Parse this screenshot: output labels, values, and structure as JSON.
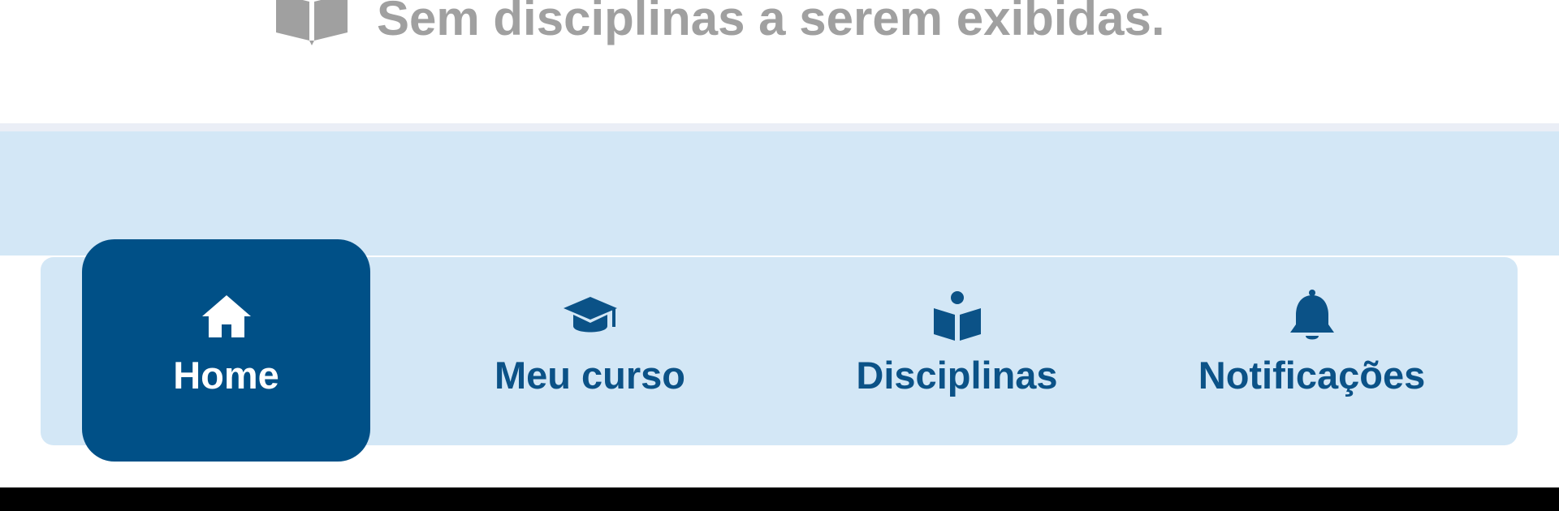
{
  "empty_state": {
    "icon": "book-icon",
    "message": "Sem disciplinas a serem exibidas."
  },
  "bottom_nav": {
    "active_index": 0,
    "items": [
      {
        "label": "Home",
        "icon": "home-icon"
      },
      {
        "label": "Meu curso",
        "icon": "graduation-cap-icon"
      },
      {
        "label": "Disciplinas",
        "icon": "book-reader-icon"
      },
      {
        "label": "Notificações",
        "icon": "bell-icon"
      }
    ]
  },
  "colors": {
    "primary": "#005087",
    "nav_background": "#d3e7f6",
    "nav_text": "#0b5287",
    "muted_text": "#a0a0a0",
    "active_text": "#ffffff"
  }
}
